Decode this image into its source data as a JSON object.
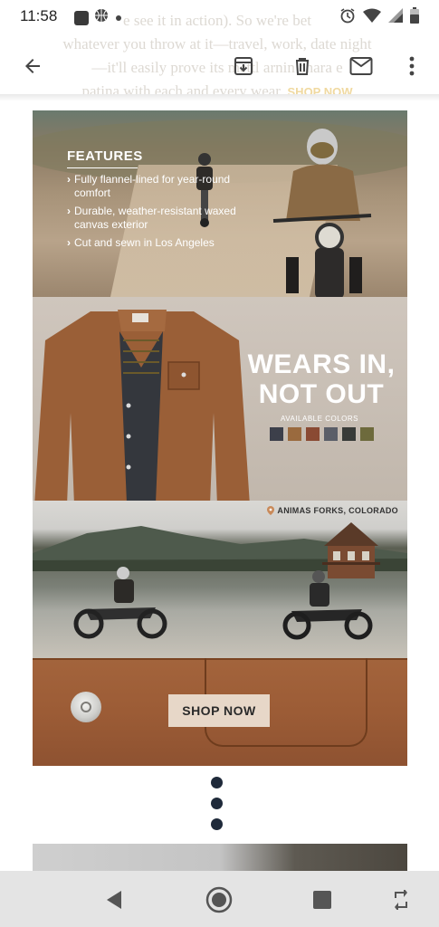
{
  "status_bar": {
    "time": "11:58",
    "left_icons": [
      "facebook-icon",
      "basketball-icon",
      "notification-dot-icon"
    ],
    "right_icons": [
      "alarm-icon",
      "wifi-icon",
      "cell-signal-icon",
      "battery-icon"
    ]
  },
  "background_text": {
    "line1": "e   see it in action). So we're bet",
    "line2": "whatever you throw at it—travel, work, date night",
    "line3": "—it'll easily prove its mettl   arnin   chara   e",
    "line4": "patina with each and every wear.",
    "cta": "SHOP NOW"
  },
  "toolbar": {
    "back_icon": "arrow-back-icon",
    "actions": [
      "archive-download-icon",
      "trash-icon",
      "mail-icon",
      "more-vert-icon"
    ]
  },
  "email": {
    "features": {
      "title": "FEATURES",
      "items": [
        "Fully flannel-lined for year-round comfort",
        "Durable, weather-resistant waxed canvas exterior",
        "Cut and sewn in Los Angeles"
      ]
    },
    "promo": {
      "title_line1": "WEARS IN,",
      "title_line2": "NOT OUT",
      "colors_label": "AVAILABLE COLORS",
      "swatch_colors": [
        "#3c3f4a",
        "#9a6a3e",
        "#8a4a33",
        "#5a5e68",
        "#383b38",
        "#6d6a3c"
      ]
    },
    "location": {
      "icon": "map-pin-icon",
      "label": "ANIMAS FORKS, COLORADO"
    },
    "cta_button": "SHOP NOW"
  },
  "nav_bar": {
    "buttons": [
      "nav-back-icon",
      "nav-home-icon",
      "nav-recents-icon",
      "rotate-icon"
    ]
  },
  "colors": {
    "accent_text": "#f0d9a0",
    "shop_button_bg": "#e7d7c8",
    "canvas_brown": "#9c5c36",
    "dot_color": "#1f2a3a"
  }
}
